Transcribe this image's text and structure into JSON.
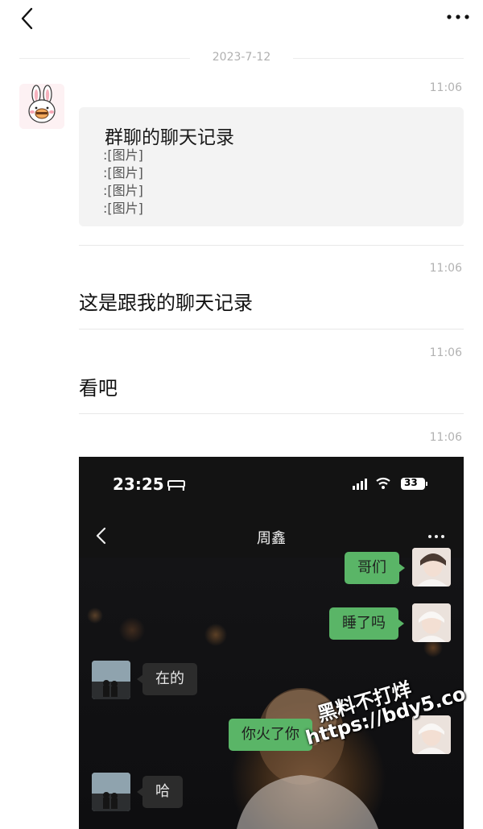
{
  "header": {
    "back_icon": "chevron-left-icon",
    "more_icon": "more-dots-icon"
  },
  "date_separator": "2023-7-12",
  "messages": [
    {
      "type": "chat_record",
      "time": "11:06",
      "title": "群聊的聊天记录",
      "lines": [
        ":[图片]",
        ":[图片]",
        ":[图片]",
        ":[图片]"
      ]
    },
    {
      "type": "text",
      "time": "11:06",
      "text": "这是跟我的聊天记录"
    },
    {
      "type": "text",
      "time": "11:06",
      "text": "看吧"
    },
    {
      "type": "image",
      "time": "11:06",
      "screenshot": {
        "status_time": "23:25",
        "battery": "33",
        "chat_title": "周鑫",
        "bubbles": [
          {
            "side": "me",
            "text": "哥们"
          },
          {
            "side": "me",
            "text": "睡了吗"
          },
          {
            "side": "them",
            "text": "在的"
          },
          {
            "side": "me",
            "text": "你火了你"
          },
          {
            "side": "them",
            "text": "哈"
          }
        ]
      }
    }
  ],
  "watermark": {
    "line1": "黑料不打烊",
    "line2": "https://bdy5.co"
  },
  "colors": {
    "accent_green": "#5ab567",
    "card_bg": "#f3f3f3",
    "time_gray": "#b2b2b2"
  }
}
